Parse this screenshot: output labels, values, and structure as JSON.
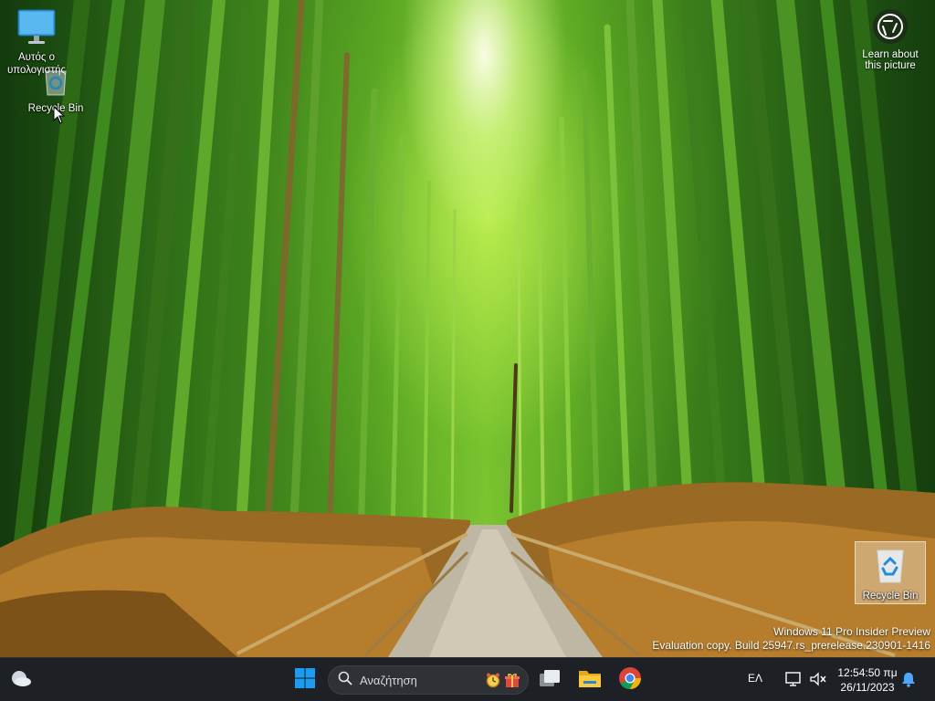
{
  "desktop": {
    "icons": [
      {
        "label": "Αυτός ο υπολογιστής"
      },
      {
        "label": "Recycle Bin"
      },
      {
        "label": "Recycle Bin"
      }
    ],
    "learn_about": "Learn about this picture",
    "watermark": {
      "line1": "Windows 11 Pro Insider Preview",
      "line2": "Evaluation copy. Build 25947.rs_prerelease.230901-1416"
    }
  },
  "taskbar": {
    "search_placeholder": "Αναζήτηση",
    "pinned": [
      "task-view",
      "file-explorer",
      "chrome"
    ],
    "tray": {
      "language": "ΕΛ",
      "time": "12:54:50 πμ",
      "date": "26/11/2023"
    }
  },
  "colors": {
    "taskbar_bg": "#1d2024",
    "accent": "#0a7bd8",
    "search_bg": "#2e3136"
  },
  "icons": [
    "monitor-icon",
    "recycle-bin-icon",
    "camera-lens-icon",
    "weather-icon",
    "windows-logo-icon",
    "search-icon",
    "task-view-icon",
    "folder-icon",
    "chrome-icon",
    "network-icon",
    "volume-muted-icon",
    "bell-icon"
  ]
}
